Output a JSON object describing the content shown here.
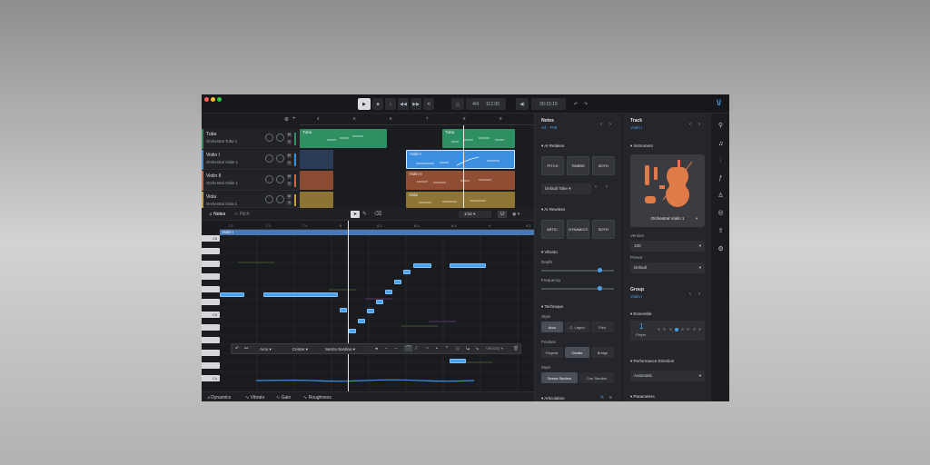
{
  "transport": {
    "time_sig": "4/4",
    "tempo": "112.00",
    "position": "00:15:15"
  },
  "tracks": [
    {
      "name": "Tuba",
      "instrument": "Orchestral Tuba 1",
      "color": "#2e8f63"
    },
    {
      "name": "Violin I",
      "instrument": "Orchestral Violin 1",
      "color": "#3c8fe0"
    },
    {
      "name": "Violin II",
      "instrument": "Orchestral Violin 1",
      "color": "#c96b43"
    },
    {
      "name": "Viola",
      "instrument": "Orchestral Viola 1",
      "color": "#c9a13a"
    }
  ],
  "clips": {
    "tuba_a": "Tuba",
    "tuba_b": "Tuba",
    "violin1": "Violin I",
    "violin2": "Violin II",
    "viola": "Viola"
  },
  "ruler_top": [
    "4",
    "5",
    "6",
    "7",
    "8",
    "9"
  ],
  "editor": {
    "tab_notes": "Notes",
    "tab_pitch": "Pitch",
    "quantize": "1/16",
    "track_label": "Violin I",
    "ruler": [
      "7.2",
      "7.3",
      "7.4",
      "8",
      "8.2",
      "8.3",
      "8.4",
      "9",
      "9.2"
    ],
    "c5": "C5",
    "c4": "C4",
    "c6": "C6"
  },
  "note_toolbar": {
    "style": "Arco",
    "position": "Center",
    "mute": "Senza Sordino",
    "velocity": "Velocity"
  },
  "automation": [
    "Dynamics",
    "Vibrato",
    "Gain",
    "Roughness"
  ],
  "notes_panel": {
    "title": "Notes",
    "range": "A4 - F#5",
    "ai_retakes": "AI Retakes",
    "pitch": "PITCH",
    "timbre": "TIMBRE",
    "both": "BOTH",
    "take": "Default Take",
    "ai_rewrites": "AI Rewrites",
    "artic": "ARTIC.",
    "dynamics": "DYNAMICS",
    "both2": "BOTH",
    "vibrato": "Vibrato",
    "depth": "Depth",
    "depth_value": 0.8,
    "frequency": "Frequency",
    "frequency_value": 0.8,
    "technique": "Technique",
    "style": "Style",
    "style_opts": [
      "Arco",
      "C. Legno",
      "Pizz."
    ],
    "position": "Position",
    "position_opts": [
      "Fingerb.",
      "Center",
      "Bridge"
    ],
    "mute": "Mute",
    "mute_opts": [
      "Senza Sordino",
      "Con Sordino"
    ],
    "articulation": "Articulation"
  },
  "track_panel": {
    "title": "Track",
    "track": "Violin I",
    "instrument": "Instrument",
    "instrument_name": "Orchestral Violin 1",
    "version": "Version",
    "version_value": "100",
    "preset": "Preset",
    "preset_value": "Default",
    "group": "Group",
    "group_value": "Violin I",
    "ensemble": "Ensemble",
    "players": "1",
    "player_label": "Player",
    "perf_dir": "Performance Direction",
    "perf_value": "Automatic",
    "parameters": "Parameters"
  },
  "colors": {
    "accent": "#4aa3ea",
    "tuba": "#2e8f63",
    "violin1": "#3c8fe0",
    "violin2": "#c96b43",
    "viola": "#c9a13a"
  }
}
